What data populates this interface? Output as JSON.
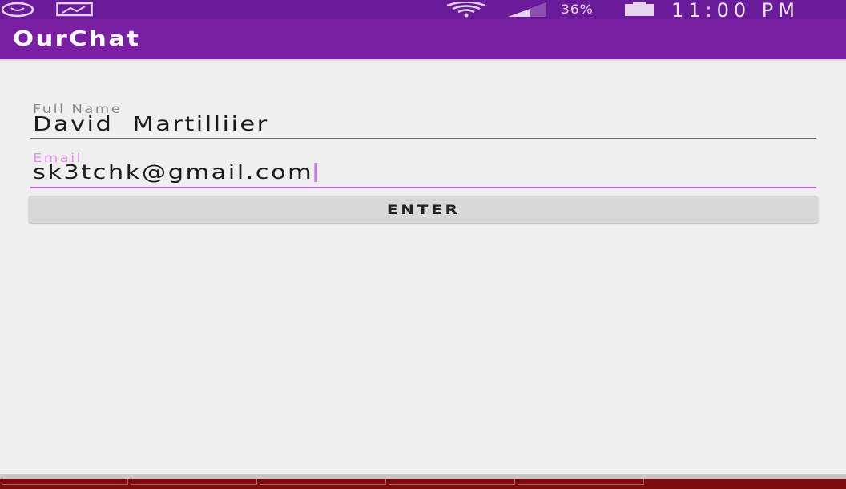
{
  "status_bar": {
    "battery_percent": "36%",
    "time": "11:00 PM",
    "icons": [
      "whatsapp-icon",
      "image-icon",
      "wifi-icon",
      "signal-icon",
      "battery-icon"
    ]
  },
  "app_bar": {
    "title": "OurChat"
  },
  "form": {
    "full_name": {
      "label": "Full Name",
      "value": "David  Martilliier"
    },
    "email": {
      "label": "Email",
      "value": "sk3tchk@gmail.com"
    },
    "enter_label": "ENTER"
  },
  "colors": {
    "status_bar": "#6a1b9a",
    "app_bar": "#7b1fa2",
    "accent": "#c061d6",
    "background": "#efefef"
  }
}
